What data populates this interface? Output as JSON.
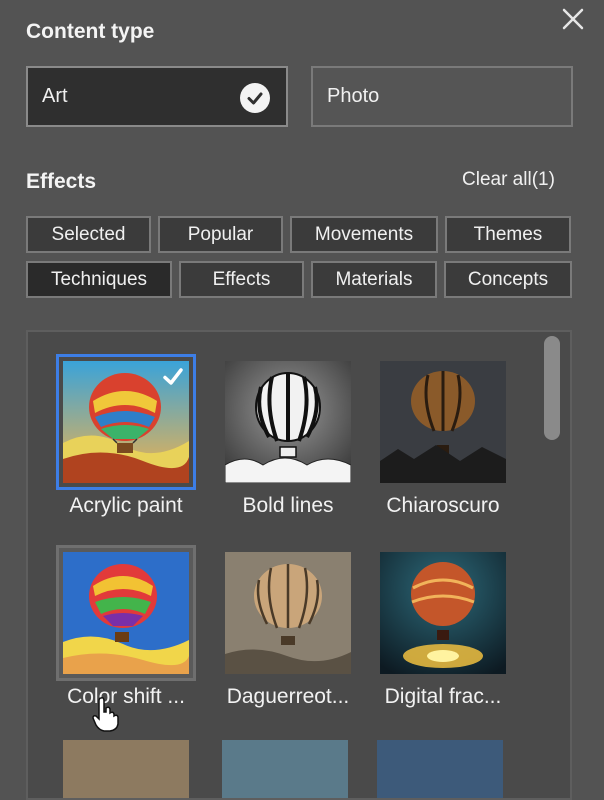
{
  "content_type": {
    "title": "Content type",
    "options": [
      {
        "label": "Art",
        "selected": true
      },
      {
        "label": "Photo",
        "selected": false
      }
    ]
  },
  "effects": {
    "title": "Effects",
    "clear_all": "Clear all(1)",
    "tabs": [
      "Selected",
      "Popular",
      "Movements",
      "Themes",
      "Techniques",
      "Effects",
      "Materials",
      "Concepts"
    ],
    "active_tab": "Techniques",
    "items": [
      {
        "label": "Acrylic paint",
        "selected": true
      },
      {
        "label": "Bold lines",
        "selected": false
      },
      {
        "label": "Chiaroscuro",
        "selected": false
      },
      {
        "label": "Color shift ...",
        "selected": false,
        "hovered": true
      },
      {
        "label": "Daguerreot...",
        "selected": false
      },
      {
        "label": "Digital frac...",
        "selected": false
      }
    ]
  },
  "colors": {
    "panel_bg": "#535353",
    "selection_blue": "#3d7ee6"
  }
}
